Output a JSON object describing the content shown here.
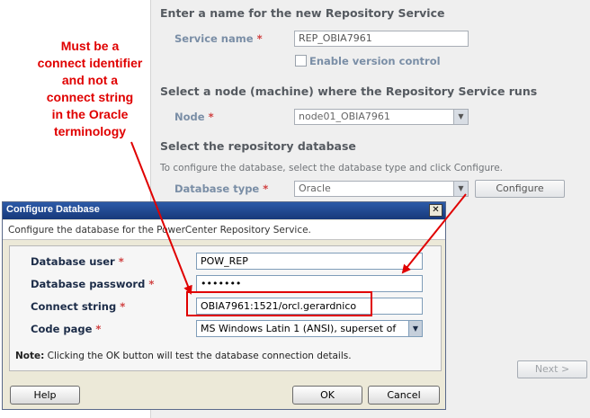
{
  "wizard": {
    "section_name_heading": "Enter a name for the new Repository Service",
    "service_name_label": "Service name",
    "service_name_value": "REP_OBIA7961",
    "enable_version_control_label": "Enable version control",
    "section_node_heading": "Select a node (machine) where the Repository Service runs",
    "node_label": "Node",
    "node_value": "node01_OBIA7961",
    "section_db_heading": "Select the repository database",
    "db_instruction": "To configure the database, select the database type and click Configure.",
    "database_type_label": "Database type",
    "database_type_value": "Oracle",
    "configure_button": "Configure",
    "next_button": "Next >",
    "required_marker": "*"
  },
  "annotation": {
    "text_lines": [
      "Must be a",
      "connect identifier",
      "and not a",
      "connect string",
      "in the Oracle",
      "terminology"
    ],
    "color": "#e00000"
  },
  "dialog": {
    "title": "Configure Database",
    "close_glyph": "✕",
    "subtitle": "Configure the database for the PowerCenter Repository Service.",
    "database_user_label": "Database user",
    "database_user_value": "POW_REP",
    "database_password_label": "Database password",
    "database_password_value": "•••••••",
    "connect_string_label": "Connect string",
    "connect_string_value": "OBIA7961:1521/orcl.gerardnico",
    "code_page_label": "Code page",
    "code_page_value": "MS Windows Latin 1 (ANSI), superset of",
    "note_bold": "Note:",
    "note_text": " Clicking the OK button will test the database connection details.",
    "help_button": "Help",
    "ok_button": "OK",
    "cancel_button": "Cancel",
    "required_marker": "*"
  },
  "icons": {
    "dropdown_arrow": "▼"
  },
  "colors": {
    "titlebar": "#17397a",
    "highlight": "#e00000",
    "label_blue": "#1c2c48"
  }
}
